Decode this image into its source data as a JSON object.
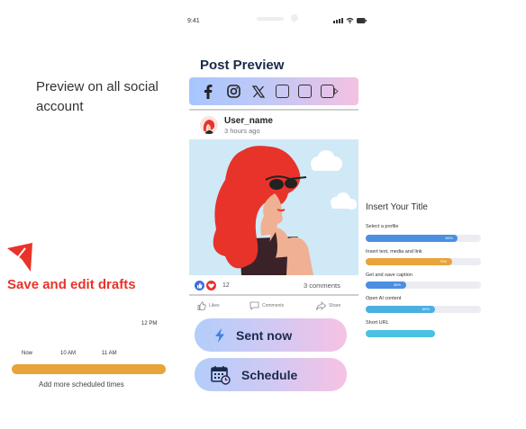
{
  "left_panel": {
    "preview_text": "Preview on all social account",
    "drafts_label": "Save and edit drafts",
    "timeline": {
      "label_12pm": "12 PM",
      "label_now": "Now",
      "label_10am": "10 AM",
      "label_11am": "11 AM",
      "caption": "Add more scheduled times",
      "bar_color": "#e8a33a"
    }
  },
  "status_bar": {
    "time": "9:41"
  },
  "post_preview": {
    "title": "Post Preview",
    "social_icons": [
      "facebook-icon",
      "instagram-icon",
      "x-icon",
      "placeholder-square",
      "placeholder-square",
      "placeholder-square"
    ],
    "user_name": "User_name",
    "posted_time": "3 hours ago",
    "reaction_count": "12",
    "comments_count": "3 comments",
    "actions": {
      "likes": "Likes",
      "comments": "Comments",
      "share": "Share"
    },
    "buttons": {
      "sent_now": "Sent now",
      "schedule": "Schedule"
    }
  },
  "form": {
    "title": "Insert Your Title",
    "steps": [
      {
        "label": "Select a profile",
        "percent_label": "80%",
        "progress": 0.8,
        "color": "#4a8fe0"
      },
      {
        "label": "Insert text, media and link",
        "percent_label": "75%",
        "progress": 0.75,
        "color": "#e8a33a"
      },
      {
        "label": "Get and save caption",
        "percent_label": "35%",
        "progress": 0.35,
        "color": "#4a8fe0"
      },
      {
        "label": "Open AI content",
        "percent_label": "60%",
        "progress": 0.6,
        "color": "#4ab0e0"
      },
      {
        "label": "Short URL",
        "percent_label": "",
        "progress": 0.6,
        "color": "#4ac2e4"
      }
    ]
  },
  "colors": {
    "accent_red": "#e8332a",
    "navy": "#1b2a4a"
  }
}
